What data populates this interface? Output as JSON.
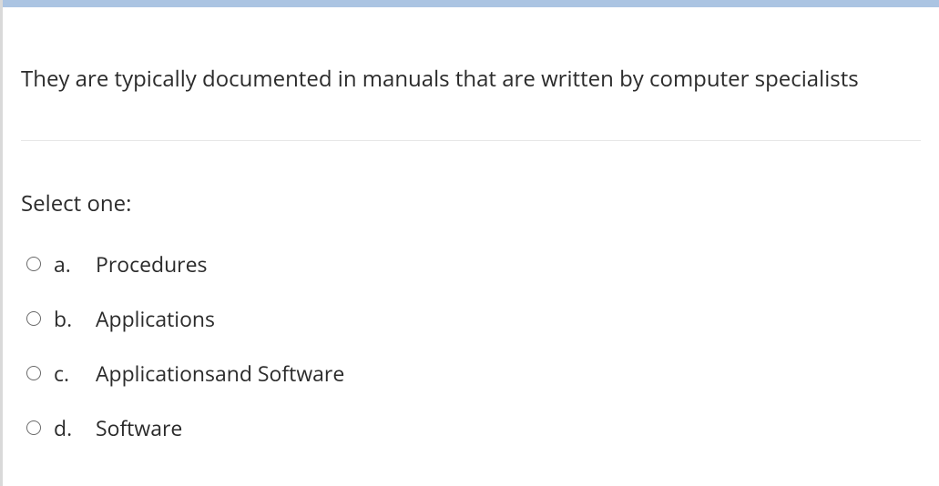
{
  "question": {
    "text": "They are typically documented in manuals that are written by computer specialists",
    "select_label": "Select one:",
    "options": [
      {
        "letter": "a.",
        "text": "Procedures"
      },
      {
        "letter": "b.",
        "text": "Applications"
      },
      {
        "letter": "c.",
        "text": "Applicationsand Software"
      },
      {
        "letter": "d.",
        "text": "Software"
      }
    ]
  }
}
